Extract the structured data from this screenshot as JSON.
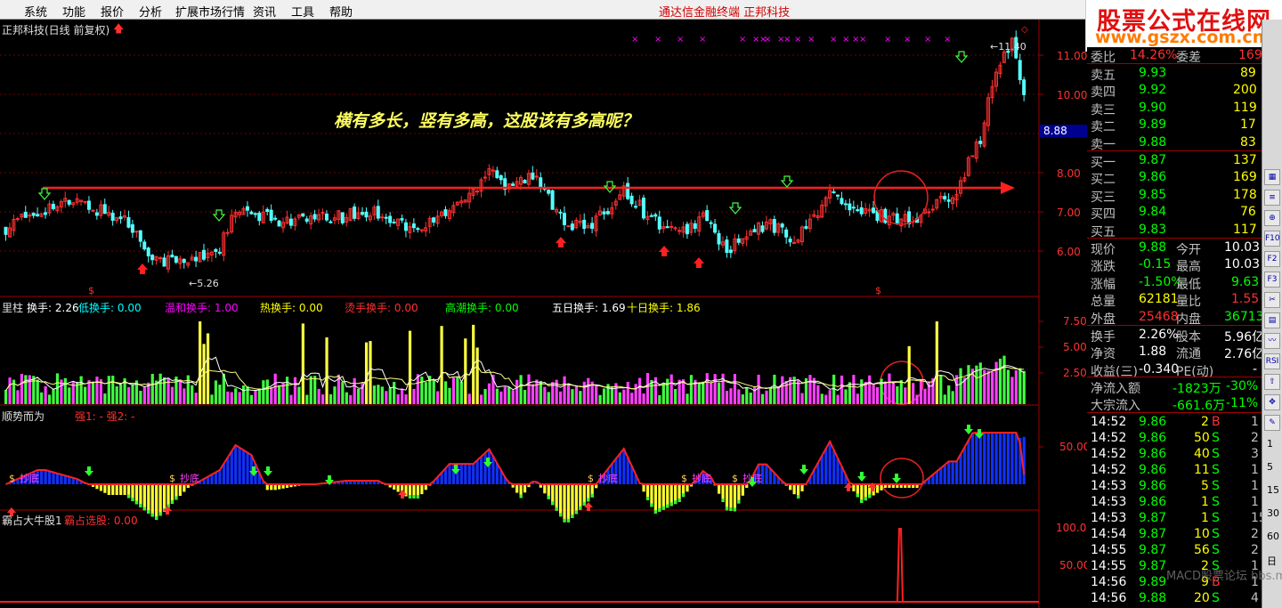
{
  "menu": [
    "系统",
    "功能",
    "报价",
    "分析",
    "扩展市场行情",
    "资讯",
    "工具",
    "帮助"
  ],
  "window_title": "通达信金融终端    正邦科技",
  "logo": {
    "line1": "股票公式在线网",
    "line2": "www.gszx.com.cn"
  },
  "main_pane": {
    "title": "正邦科技(日线 前复权)",
    "annotation": "横有多长，竖有多高，这股该有多高呢？",
    "price_axis": [
      "11.00",
      "10.00",
      "8.00",
      "7.00",
      "6.00"
    ],
    "current_price_tag": "8.88",
    "high_label": "11.40",
    "low_label": "5.26",
    "s_marker": "$"
  },
  "volume_pane": {
    "label": "里柱",
    "items": [
      {
        "name": "换手:",
        "value": "2.26",
        "color": "#ffffff"
      },
      {
        "name": "低换手:",
        "value": "0.00",
        "color": "#00ffff"
      },
      {
        "name": "温和换手:",
        "value": "1.00",
        "color": "#ff00ff"
      },
      {
        "name": "热换手:",
        "value": "0.00",
        "color": "#ffff00"
      },
      {
        "name": "烫手换手:",
        "value": "0.00",
        "color": "#ff3030"
      },
      {
        "name": "高潮换手:",
        "value": "0.00",
        "color": "#00ff00"
      },
      {
        "name": "五日换手:",
        "value": "1.69",
        "color": "#ffffff"
      },
      {
        "name": "十日换手:",
        "value": "1.86",
        "color": "#ffff00"
      }
    ],
    "axis": [
      "7.50",
      "5.00",
      "2.50"
    ]
  },
  "trend_pane": {
    "label": "顺势而为",
    "items": "强1: -  强2: -",
    "axis": [
      "50.00"
    ],
    "marker_text": "抄底"
  },
  "bottom_pane": {
    "label": "霸占大牛股1",
    "items": "霸占选股: 0.00",
    "axis": [
      "100.00",
      "50.00"
    ]
  },
  "quote": {
    "header": {
      "wb": "委比",
      "wb_val": "14.26%",
      "wc": "委差",
      "wc_val": "169"
    },
    "sell": [
      {
        "label": "卖五",
        "price": "9.93",
        "vol": "89"
      },
      {
        "label": "卖四",
        "price": "9.92",
        "vol": "200"
      },
      {
        "label": "卖三",
        "price": "9.90",
        "vol": "119"
      },
      {
        "label": "卖二",
        "price": "9.89",
        "vol": "17"
      },
      {
        "label": "卖一",
        "price": "9.88",
        "vol": "83"
      }
    ],
    "buy": [
      {
        "label": "买一",
        "price": "9.87",
        "vol": "137"
      },
      {
        "label": "买二",
        "price": "9.86",
        "vol": "169"
      },
      {
        "label": "买三",
        "price": "9.85",
        "vol": "178"
      },
      {
        "label": "买四",
        "price": "9.84",
        "vol": "76"
      },
      {
        "label": "买五",
        "price": "9.83",
        "vol": "117"
      }
    ],
    "stats": [
      {
        "l1": "现价",
        "v1": "9.88",
        "c1": "#00ff00",
        "l2": "今开",
        "v2": "10.03",
        "c2": "#ffffff"
      },
      {
        "l1": "涨跌",
        "v1": "-0.15",
        "c1": "#00ff00",
        "l2": "最高",
        "v2": "10.03",
        "c2": "#ffffff"
      },
      {
        "l1": "涨幅",
        "v1": "-1.50%",
        "c1": "#00ff00",
        "l2": "最低",
        "v2": "9.63",
        "c2": "#00ff00"
      },
      {
        "l1": "总量",
        "v1": "62181",
        "c1": "#ffff00",
        "l2": "量比",
        "v2": "1.55",
        "c2": "#ff3030"
      },
      {
        "l1": "外盘",
        "v1": "25468",
        "c1": "#ff3030",
        "l2": "内盘",
        "v2": "36713",
        "c2": "#00ff00"
      }
    ],
    "stats2": [
      {
        "l1": "换手",
        "v1": "2.26%",
        "c1": "#ffffff",
        "l2": "股本",
        "v2": "5.96亿",
        "c2": "#ffffff"
      },
      {
        "l1": "净资",
        "v1": "1.88",
        "c1": "#ffffff",
        "l2": "流通",
        "v2": "2.76亿",
        "c2": "#ffffff"
      },
      {
        "l1": "收益(三)",
        "v1": "-0.340",
        "c1": "#ffffff",
        "l2": "PE(动)",
        "v2": "-",
        "c2": "#ffffff"
      }
    ],
    "flow": [
      {
        "label": "净流入额",
        "v1": "-1823万",
        "v2": "-30%"
      },
      {
        "label": "大宗流入",
        "v1": "-661.6万",
        "v2": "-11%"
      }
    ],
    "ticks": [
      {
        "t": "14:52",
        "p": "9.86",
        "v": "2",
        "bs": "B",
        "n": "1"
      },
      {
        "t": "14:52",
        "p": "9.86",
        "v": "50",
        "bs": "S",
        "n": "2"
      },
      {
        "t": "14:52",
        "p": "9.86",
        "v": "40",
        "bs": "S",
        "n": "3"
      },
      {
        "t": "14:52",
        "p": "9.86",
        "v": "11",
        "bs": "S",
        "n": "1"
      },
      {
        "t": "14:53",
        "p": "9.86",
        "v": "5",
        "bs": "S",
        "n": "1"
      },
      {
        "t": "14:53",
        "p": "9.86",
        "v": "1",
        "bs": "S",
        "n": "1"
      },
      {
        "t": "14:53",
        "p": "9.87",
        "v": "1",
        "bs": "S",
        "n": "15"
      },
      {
        "t": "14:54",
        "p": "9.87",
        "v": "10",
        "bs": "S",
        "n": "2"
      },
      {
        "t": "14:55",
        "p": "9.87",
        "v": "56",
        "bs": "S",
        "n": "2"
      },
      {
        "t": "14:55",
        "p": "9.87",
        "v": "2",
        "bs": "S",
        "n": "1"
      },
      {
        "t": "14:56",
        "p": "9.89",
        "v": "9",
        "bs": "B",
        "n": "1"
      },
      {
        "t": "14:56",
        "p": "9.88",
        "v": "20",
        "bs": "S",
        "n": "4"
      }
    ]
  },
  "toolbar_icons": [
    "grid-icon",
    "rank-icon",
    "zoom-icon",
    "f10-icon",
    "f2-icon",
    "f3-icon",
    "cut-icon",
    "notes-icon",
    "chart-icon",
    "rsi-icon",
    "arrow-icon",
    "move-icon",
    "pencil-icon"
  ],
  "watermark": "MACD股票论坛 bbs.macd.cn",
  "side_periods": [
    "1",
    "5",
    "15",
    "30",
    "60",
    "日"
  ],
  "colors": {
    "up": "#ff3030",
    "down": "#54ffff",
    "grid": "#a00000"
  }
}
